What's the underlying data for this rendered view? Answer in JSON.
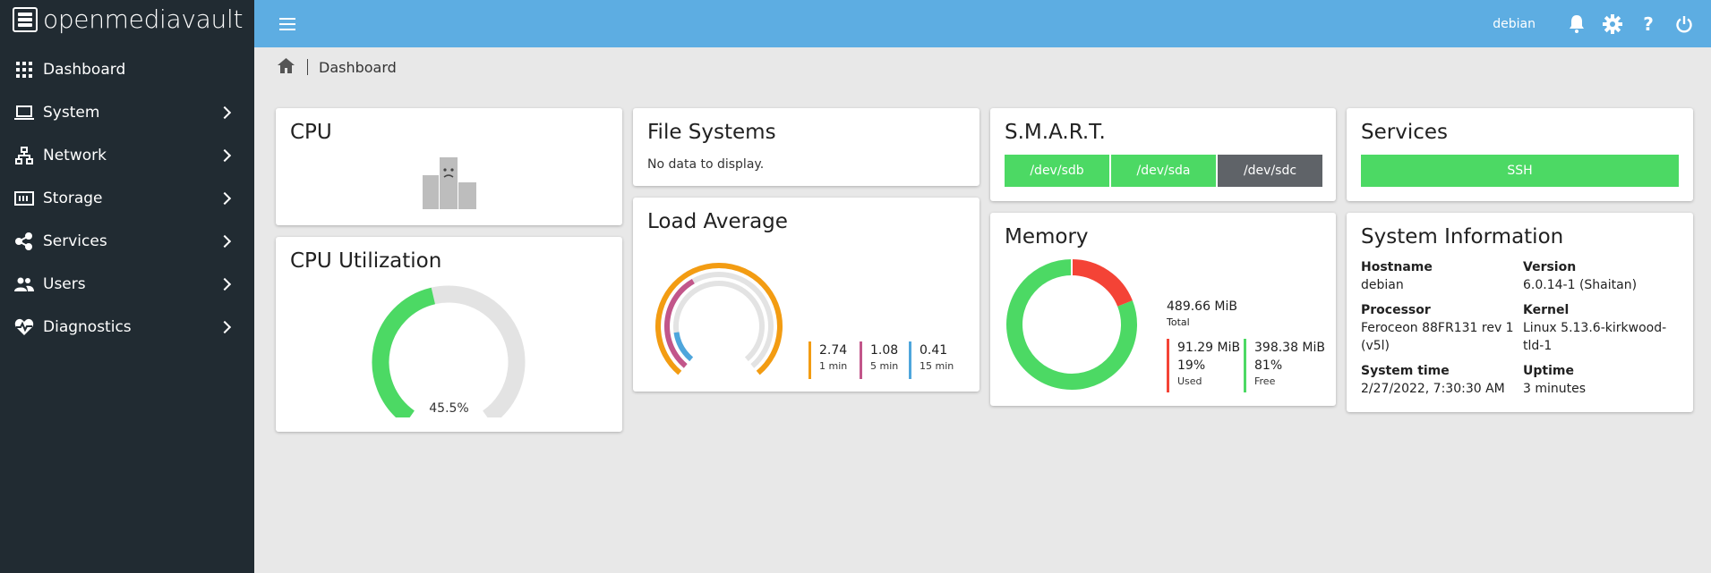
{
  "app": {
    "brand": "openmediavault"
  },
  "sidebar": {
    "items": [
      {
        "label": "Dashboard",
        "icon": "grid-icon",
        "has_children": false
      },
      {
        "label": "System",
        "icon": "laptop-icon",
        "has_children": true
      },
      {
        "label": "Network",
        "icon": "network-icon",
        "has_children": true
      },
      {
        "label": "Storage",
        "icon": "storage-icon",
        "has_children": true
      },
      {
        "label": "Services",
        "icon": "share-icon",
        "has_children": true
      },
      {
        "label": "Users",
        "icon": "users-icon",
        "has_children": true
      },
      {
        "label": "Diagnostics",
        "icon": "heartbeat-icon",
        "has_children": true
      }
    ]
  },
  "topbar": {
    "username": "debian",
    "icons": [
      "bell-icon",
      "gear-icon",
      "help-icon",
      "power-icon"
    ]
  },
  "breadcrumb": {
    "current": "Dashboard"
  },
  "cards": {
    "cpu": {
      "title": "CPU"
    },
    "cpu_utilization": {
      "title": "CPU Utilization",
      "value_label": "45.5%",
      "percent": 45.5
    },
    "file_systems": {
      "title": "File Systems",
      "empty_text": "No data to display."
    },
    "load_average": {
      "title": "Load Average",
      "entries": [
        {
          "value": "2.74",
          "label": "1 min",
          "color": "#f39c12"
        },
        {
          "value": "1.08",
          "label": "5 min",
          "color": "#c2568a"
        },
        {
          "value": "0.41",
          "label": "15 min",
          "color": "#4ea6dc"
        }
      ]
    },
    "smart": {
      "title": "S.M.A.R.T.",
      "devices": [
        {
          "name": "/dev/sdb",
          "color": "#4cd964"
        },
        {
          "name": "/dev/sda",
          "color": "#4cd964"
        },
        {
          "name": "/dev/sdc",
          "color": "#5f6368"
        }
      ]
    },
    "memory": {
      "title": "Memory",
      "total_value": "489.66 MiB",
      "total_label": "Total",
      "used_value": "91.29 MiB",
      "used_percent": "19%",
      "used_label": "Used",
      "free_value": "398.38 MiB",
      "free_percent": "81%",
      "free_label": "Free",
      "used_color": "#f44336",
      "free_color": "#4cd964"
    },
    "services": {
      "title": "Services",
      "items": [
        {
          "name": "SSH",
          "color": "#4cd964"
        }
      ]
    },
    "system_information": {
      "title": "System Information",
      "hostname_label": "Hostname",
      "hostname": "debian",
      "version_label": "Version",
      "version": "6.0.14-1 (Shaitan)",
      "processor_label": "Processor",
      "processor_line1": "Feroceon 88FR131 rev 1",
      "processor_line2": "(v5l)",
      "kernel_label": "Kernel",
      "kernel_line1": "Linux 5.13.6-kirkwood-",
      "kernel_line2": "tld-1",
      "system_time_label": "System time",
      "system_time": "2/27/2022, 7:30:30 AM",
      "uptime_label": "Uptime",
      "uptime": "3 minutes"
    }
  },
  "colors": {
    "topbar": "#5dade2",
    "sidebar": "#212b32",
    "green": "#4cd964",
    "gray_track": "#e3e3e3"
  }
}
